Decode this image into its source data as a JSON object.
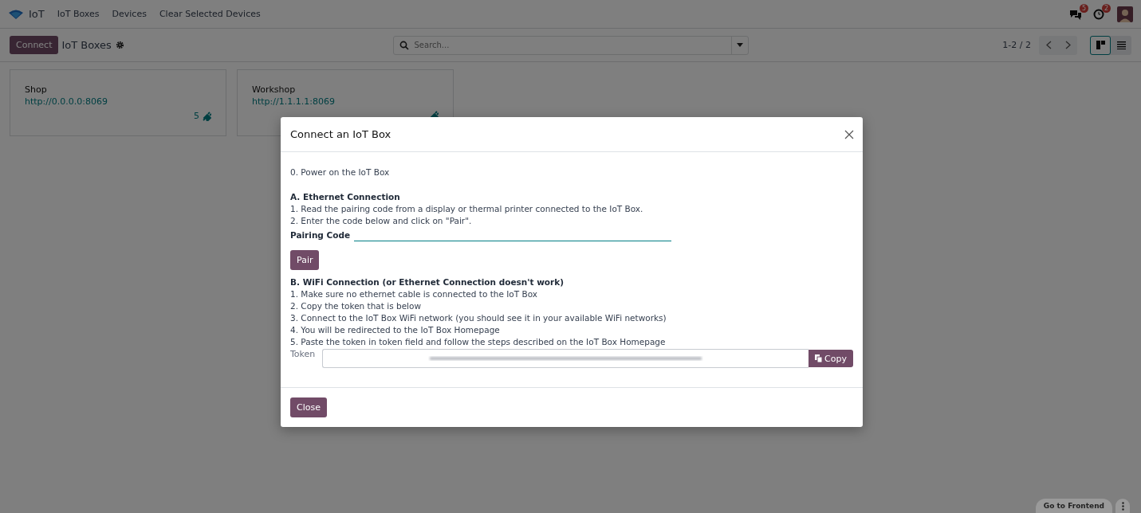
{
  "navbar": {
    "app_name": "IoT",
    "menu": [
      "IoT Boxes",
      "Devices",
      "Clear Selected Devices"
    ],
    "messages_badge": "5",
    "activities_badge": "2"
  },
  "control_panel": {
    "connect_button": "Connect",
    "title": "IoT Boxes",
    "search": {
      "placeholder": "Search..."
    },
    "pager": "1-2 / 2",
    "views": [
      {
        "kind": "kanban",
        "selected": true
      },
      {
        "kind": "list",
        "selected": false
      }
    ]
  },
  "boxes": [
    {
      "name": "Shop",
      "url": "http://0.0.0.0:8069",
      "device_count": "5"
    },
    {
      "name": "Workshop",
      "url": "http://1.1.1.1:8069"
    }
  ],
  "dialog": {
    "title": "Connect an IoT Box",
    "intro": "0. Power on the IoT Box",
    "ethernet": {
      "heading": "A. Ethernet Connection",
      "steps": [
        "1. Read the pairing code from a display or thermal printer connected to the IoT Box.",
        "2. Enter the code below and click on \"Pair\"."
      ],
      "field_label": "Pairing Code",
      "button": "Pair"
    },
    "wifi": {
      "heading": "B. WiFi Connection (or Ethernet Connection doesn't work)",
      "steps": [
        "1. Make sure no ethernet cable is connected to the IoT Box",
        "2. Copy the token that is below",
        "3. Connect to the IoT Box WiFi network (you should see it in your available WiFi networks)",
        "4. You will be redirected to the IoT Box Homepage",
        "5. Paste the token in token field and follow the steps described on the IoT Box Homepage"
      ],
      "field_label": "Token",
      "copy_button": "Copy"
    },
    "close_button": "Close"
  },
  "footer_button": "Go to Frontend"
}
